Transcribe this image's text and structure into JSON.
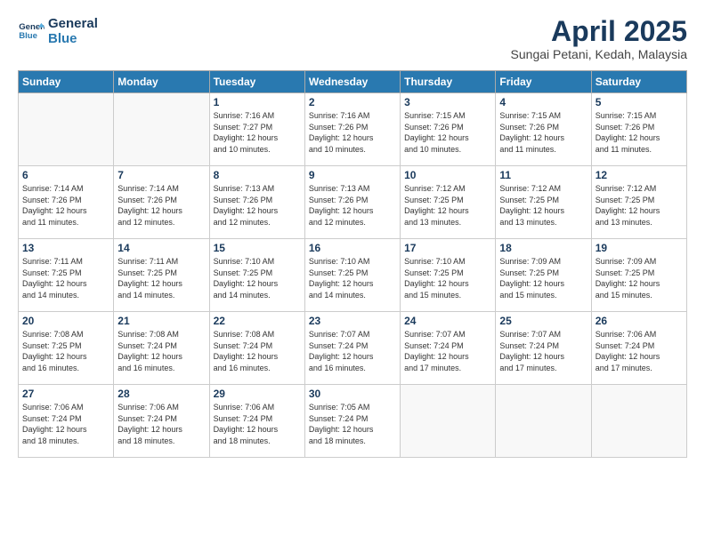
{
  "logo": {
    "line1": "General",
    "line2": "Blue"
  },
  "title": "April 2025",
  "subtitle": "Sungai Petani, Kedah, Malaysia",
  "weekdays": [
    "Sunday",
    "Monday",
    "Tuesday",
    "Wednesday",
    "Thursday",
    "Friday",
    "Saturday"
  ],
  "weeks": [
    [
      {
        "day": "",
        "info": ""
      },
      {
        "day": "",
        "info": ""
      },
      {
        "day": "1",
        "info": "Sunrise: 7:16 AM\nSunset: 7:27 PM\nDaylight: 12 hours\nand 10 minutes."
      },
      {
        "day": "2",
        "info": "Sunrise: 7:16 AM\nSunset: 7:26 PM\nDaylight: 12 hours\nand 10 minutes."
      },
      {
        "day": "3",
        "info": "Sunrise: 7:15 AM\nSunset: 7:26 PM\nDaylight: 12 hours\nand 10 minutes."
      },
      {
        "day": "4",
        "info": "Sunrise: 7:15 AM\nSunset: 7:26 PM\nDaylight: 12 hours\nand 11 minutes."
      },
      {
        "day": "5",
        "info": "Sunrise: 7:15 AM\nSunset: 7:26 PM\nDaylight: 12 hours\nand 11 minutes."
      }
    ],
    [
      {
        "day": "6",
        "info": "Sunrise: 7:14 AM\nSunset: 7:26 PM\nDaylight: 12 hours\nand 11 minutes."
      },
      {
        "day": "7",
        "info": "Sunrise: 7:14 AM\nSunset: 7:26 PM\nDaylight: 12 hours\nand 12 minutes."
      },
      {
        "day": "8",
        "info": "Sunrise: 7:13 AM\nSunset: 7:26 PM\nDaylight: 12 hours\nand 12 minutes."
      },
      {
        "day": "9",
        "info": "Sunrise: 7:13 AM\nSunset: 7:26 PM\nDaylight: 12 hours\nand 12 minutes."
      },
      {
        "day": "10",
        "info": "Sunrise: 7:12 AM\nSunset: 7:25 PM\nDaylight: 12 hours\nand 13 minutes."
      },
      {
        "day": "11",
        "info": "Sunrise: 7:12 AM\nSunset: 7:25 PM\nDaylight: 12 hours\nand 13 minutes."
      },
      {
        "day": "12",
        "info": "Sunrise: 7:12 AM\nSunset: 7:25 PM\nDaylight: 12 hours\nand 13 minutes."
      }
    ],
    [
      {
        "day": "13",
        "info": "Sunrise: 7:11 AM\nSunset: 7:25 PM\nDaylight: 12 hours\nand 14 minutes."
      },
      {
        "day": "14",
        "info": "Sunrise: 7:11 AM\nSunset: 7:25 PM\nDaylight: 12 hours\nand 14 minutes."
      },
      {
        "day": "15",
        "info": "Sunrise: 7:10 AM\nSunset: 7:25 PM\nDaylight: 12 hours\nand 14 minutes."
      },
      {
        "day": "16",
        "info": "Sunrise: 7:10 AM\nSunset: 7:25 PM\nDaylight: 12 hours\nand 14 minutes."
      },
      {
        "day": "17",
        "info": "Sunrise: 7:10 AM\nSunset: 7:25 PM\nDaylight: 12 hours\nand 15 minutes."
      },
      {
        "day": "18",
        "info": "Sunrise: 7:09 AM\nSunset: 7:25 PM\nDaylight: 12 hours\nand 15 minutes."
      },
      {
        "day": "19",
        "info": "Sunrise: 7:09 AM\nSunset: 7:25 PM\nDaylight: 12 hours\nand 15 minutes."
      }
    ],
    [
      {
        "day": "20",
        "info": "Sunrise: 7:08 AM\nSunset: 7:25 PM\nDaylight: 12 hours\nand 16 minutes."
      },
      {
        "day": "21",
        "info": "Sunrise: 7:08 AM\nSunset: 7:24 PM\nDaylight: 12 hours\nand 16 minutes."
      },
      {
        "day": "22",
        "info": "Sunrise: 7:08 AM\nSunset: 7:24 PM\nDaylight: 12 hours\nand 16 minutes."
      },
      {
        "day": "23",
        "info": "Sunrise: 7:07 AM\nSunset: 7:24 PM\nDaylight: 12 hours\nand 16 minutes."
      },
      {
        "day": "24",
        "info": "Sunrise: 7:07 AM\nSunset: 7:24 PM\nDaylight: 12 hours\nand 17 minutes."
      },
      {
        "day": "25",
        "info": "Sunrise: 7:07 AM\nSunset: 7:24 PM\nDaylight: 12 hours\nand 17 minutes."
      },
      {
        "day": "26",
        "info": "Sunrise: 7:06 AM\nSunset: 7:24 PM\nDaylight: 12 hours\nand 17 minutes."
      }
    ],
    [
      {
        "day": "27",
        "info": "Sunrise: 7:06 AM\nSunset: 7:24 PM\nDaylight: 12 hours\nand 18 minutes."
      },
      {
        "day": "28",
        "info": "Sunrise: 7:06 AM\nSunset: 7:24 PM\nDaylight: 12 hours\nand 18 minutes."
      },
      {
        "day": "29",
        "info": "Sunrise: 7:06 AM\nSunset: 7:24 PM\nDaylight: 12 hours\nand 18 minutes."
      },
      {
        "day": "30",
        "info": "Sunrise: 7:05 AM\nSunset: 7:24 PM\nDaylight: 12 hours\nand 18 minutes."
      },
      {
        "day": "",
        "info": ""
      },
      {
        "day": "",
        "info": ""
      },
      {
        "day": "",
        "info": ""
      }
    ]
  ]
}
